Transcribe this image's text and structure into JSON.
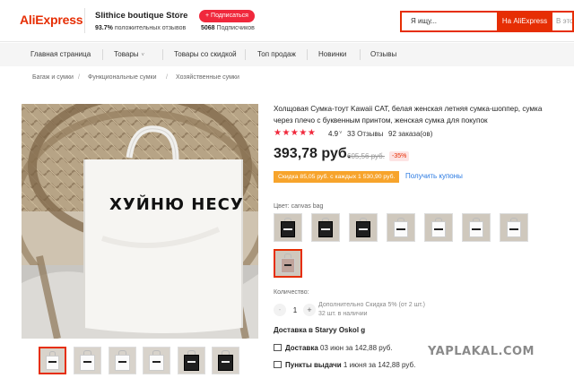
{
  "header": {
    "logo": "AliExpress",
    "store_name": "Slithice boutique Store",
    "store_caret": "˅",
    "positive_pct": "93.7%",
    "positive_text": "положительных отзывов",
    "subscribe_label": "+ Подписаться",
    "subscribers_count": "5068",
    "subscribers_text": "Подписчиков",
    "search_placeholder": "Я ищу...",
    "search_button": "На AliExpress",
    "search_extra": "В это"
  },
  "nav": {
    "items": [
      "Главная страница",
      "Товары",
      "Товары со скидкой",
      "Топ продаж",
      "Новинки",
      "Отзывы"
    ],
    "caret": "˅"
  },
  "breadcrumb": [
    "Багаж и сумки",
    "Функциональные сумки",
    "Хозяйственные сумки"
  ],
  "product": {
    "title": "Холщовая Сумка-тоут Kawaii CAT, белая женская летняя сумка-шоппер, сумка через плечо с буквенным принтом, женская сумка для покупок",
    "stars": "★★★★★",
    "rating": "4.9",
    "rating_caret": "˅",
    "reviews": "33 Отзывы",
    "orders": "92 заказа(ов)",
    "price": "393,78 руб.",
    "old_price": "605,56 руб.",
    "discount": "-35%",
    "coupon": "Скидка 85,05 руб. с каждых 1 530,90 руб.",
    "coupon_link": "Получить купоны",
    "bag_print": "ХУЙНЮ НЕСУ",
    "color_label": "Цвет: canvas bag",
    "qty_label": "Количество:",
    "qty_minus": "-",
    "qty_value": "1",
    "qty_plus": "+",
    "qty_note": "Дополнительно Скидка 5% (от 2 шт.)",
    "qty_stock": "32 шт. в наличии",
    "ship_to": "Доставка в Staryy Oskol g",
    "delivery_label": "Доставка",
    "delivery_text": "03 июн за 142,88 руб.",
    "pickup_label": "Пункты выдачи",
    "pickup_text": "1 июня за 142,88 руб."
  },
  "watermark": "YAPLAKAL.COM"
}
